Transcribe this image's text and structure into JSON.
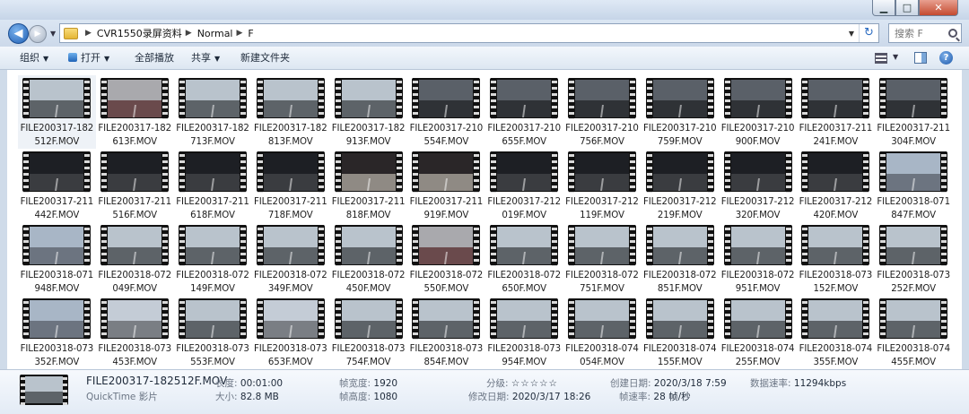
{
  "window": {
    "controls": {
      "minimize": "▁",
      "maximize": "□",
      "close": "✕"
    }
  },
  "address": {
    "crumbs": [
      "CVR1550录屏资料",
      "Normal",
      "F"
    ],
    "search_placeholder": "搜索 F"
  },
  "toolbar": {
    "organize": "组织",
    "open": "打开",
    "play_all": "全部播放",
    "share": "共享",
    "new_folder": "新建文件夹"
  },
  "files": [
    {
      "l1": "FILE200317-182",
      "l2": "512F.MOV",
      "scene": "day",
      "selected": true
    },
    {
      "l1": "FILE200317-182",
      "l2": "613F.MOV",
      "scene": "red"
    },
    {
      "l1": "FILE200317-182",
      "l2": "713F.MOV",
      "scene": "day"
    },
    {
      "l1": "FILE200317-182",
      "l2": "813F.MOV",
      "scene": "day"
    },
    {
      "l1": "FILE200317-182",
      "l2": "913F.MOV",
      "scene": "day"
    },
    {
      "l1": "FILE200317-210",
      "l2": "554F.MOV",
      "scene": "dusk"
    },
    {
      "l1": "FILE200317-210",
      "l2": "655F.MOV",
      "scene": "dusk"
    },
    {
      "l1": "FILE200317-210",
      "l2": "756F.MOV",
      "scene": "dusk"
    },
    {
      "l1": "FILE200317-210",
      "l2": "759F.MOV",
      "scene": "dusk"
    },
    {
      "l1": "FILE200317-210",
      "l2": "900F.MOV",
      "scene": "dusk"
    },
    {
      "l1": "FILE200317-211",
      "l2": "241F.MOV",
      "scene": "dusk"
    },
    {
      "l1": "FILE200317-211",
      "l2": "304F.MOV",
      "scene": "dusk"
    },
    {
      "l1": "FILE200317-211",
      "l2": "442F.MOV",
      "scene": "night"
    },
    {
      "l1": "FILE200317-211",
      "l2": "516F.MOV",
      "scene": "night"
    },
    {
      "l1": "FILE200317-211",
      "l2": "618F.MOV",
      "scene": "night"
    },
    {
      "l1": "FILE200317-211",
      "l2": "718F.MOV",
      "scene": "night"
    },
    {
      "l1": "FILE200317-211",
      "l2": "818F.MOV",
      "scene": "nightlight"
    },
    {
      "l1": "FILE200317-211",
      "l2": "919F.MOV",
      "scene": "nightlight"
    },
    {
      "l1": "FILE200317-212",
      "l2": "019F.MOV",
      "scene": "night"
    },
    {
      "l1": "FILE200317-212",
      "l2": "119F.MOV",
      "scene": "night"
    },
    {
      "l1": "FILE200317-212",
      "l2": "219F.MOV",
      "scene": "night"
    },
    {
      "l1": "FILE200317-212",
      "l2": "320F.MOV",
      "scene": "night"
    },
    {
      "l1": "FILE200317-212",
      "l2": "420F.MOV",
      "scene": "night"
    },
    {
      "l1": "FILE200318-071",
      "l2": "847F.MOV",
      "scene": "morning"
    },
    {
      "l1": "FILE200318-071",
      "l2": "948F.MOV",
      "scene": "morning"
    },
    {
      "l1": "FILE200318-072",
      "l2": "049F.MOV",
      "scene": "day"
    },
    {
      "l1": "FILE200318-072",
      "l2": "149F.MOV",
      "scene": "day"
    },
    {
      "l1": "FILE200318-072",
      "l2": "349F.MOV",
      "scene": "day"
    },
    {
      "l1": "FILE200318-072",
      "l2": "450F.MOV",
      "scene": "day"
    },
    {
      "l1": "FILE200318-072",
      "l2": "550F.MOV",
      "scene": "red"
    },
    {
      "l1": "FILE200318-072",
      "l2": "650F.MOV",
      "scene": "day"
    },
    {
      "l1": "FILE200318-072",
      "l2": "751F.MOV",
      "scene": "day"
    },
    {
      "l1": "FILE200318-072",
      "l2": "851F.MOV",
      "scene": "day"
    },
    {
      "l1": "FILE200318-072",
      "l2": "951F.MOV",
      "scene": "day"
    },
    {
      "l1": "FILE200318-073",
      "l2": "152F.MOV",
      "scene": "day"
    },
    {
      "l1": "FILE200318-073",
      "l2": "252F.MOV",
      "scene": "day"
    },
    {
      "l1": "FILE200318-073",
      "l2": "352F.MOV",
      "scene": "morning"
    },
    {
      "l1": "FILE200318-073",
      "l2": "453F.MOV",
      "scene": "tunnel"
    },
    {
      "l1": "FILE200318-073",
      "l2": "553F.MOV",
      "scene": "day"
    },
    {
      "l1": "FILE200318-073",
      "l2": "653F.MOV",
      "scene": "tunnel"
    },
    {
      "l1": "FILE200318-073",
      "l2": "754F.MOV",
      "scene": "day"
    },
    {
      "l1": "FILE200318-073",
      "l2": "854F.MOV",
      "scene": "day"
    },
    {
      "l1": "FILE200318-073",
      "l2": "954F.MOV",
      "scene": "day"
    },
    {
      "l1": "FILE200318-074",
      "l2": "054F.MOV",
      "scene": "day"
    },
    {
      "l1": "FILE200318-074",
      "l2": "155F.MOV",
      "scene": "day"
    },
    {
      "l1": "FILE200318-074",
      "l2": "255F.MOV",
      "scene": "day"
    },
    {
      "l1": "FILE200318-074",
      "l2": "355F.MOV",
      "scene": "day"
    },
    {
      "l1": "FILE200318-074",
      "l2": "455F.MOV",
      "scene": "day"
    }
  ],
  "scenes": {
    "day": {
      "sky": "#b9c3cc",
      "road": "#5d6368"
    },
    "red": {
      "sky": "#a9a9ad",
      "road": "#6a4a4c"
    },
    "dusk": {
      "sky": "#5a6068",
      "road": "#2f3236"
    },
    "night": {
      "sky": "#1d1f24",
      "road": "#3a3c40"
    },
    "nightlight": {
      "sky": "#2a2628",
      "road": "#8f8a84"
    },
    "morning": {
      "sky": "#a8b6c6",
      "road": "#6c7480"
    },
    "tunnel": {
      "sky": "#c4ccd6",
      "road": "#7a7e84"
    }
  },
  "details": {
    "name": "FILE200317-182512F.MOV",
    "type": "QuickTime 影片",
    "length_k": "长度:",
    "length_v": "00:01:00",
    "size_k": "大小:",
    "size_v": "82.8 MB",
    "width_k": "帧宽度:",
    "width_v": "1920",
    "height_k": "帧高度:",
    "height_v": "1080",
    "rating_k": "分级:",
    "rating_v": "☆☆☆☆☆",
    "modified_k": "修改日期:",
    "modified_v": "2020/3/17 18:26",
    "created_k": "创建日期:",
    "created_v": "2020/3/18 7:59",
    "fps_k": "帧速率:",
    "fps_v": "28 帧/秒",
    "bitrate_k": "数据速率:",
    "bitrate_v": "11294kbps"
  }
}
